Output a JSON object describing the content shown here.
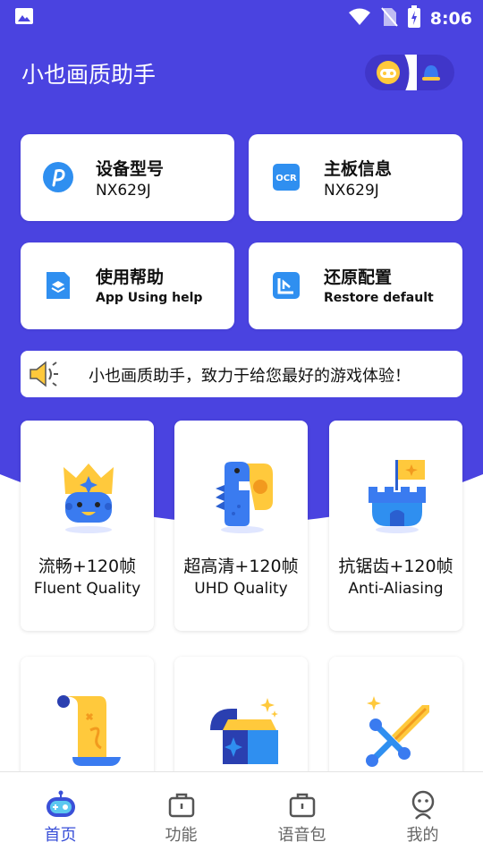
{
  "status_bar": {
    "time": "8:06"
  },
  "header": {
    "title": "小也画质助手"
  },
  "info_cards": [
    {
      "title": "设备型号",
      "value": "NX629J",
      "icon": "brand-p-icon"
    },
    {
      "title": "主板信息",
      "value": "NX629J",
      "icon": "ocr-icon"
    },
    {
      "title": "使用帮助",
      "value": "App Using help",
      "icon": "help-layers-icon"
    },
    {
      "title": "还原配置",
      "value": "Restore default",
      "icon": "restore-icon"
    }
  ],
  "notice": {
    "text": "小也画质助手，致力于给您最好的游戏体验！"
  },
  "modes": [
    {
      "label_cn": "流畅+120帧",
      "label_en": "Fluent Quality",
      "icon": "crown-king-icon"
    },
    {
      "label_cn": "超高清+120帧",
      "label_en": "UHD Quality",
      "icon": "dinosaur-icon"
    },
    {
      "label_cn": "抗锯齿+120帧",
      "label_en": "Anti-Aliasing",
      "icon": "castle-flag-icon"
    },
    {
      "label_cn": "",
      "label_en": "",
      "icon": "scroll-map-icon"
    },
    {
      "label_cn": "",
      "label_en": "",
      "icon": "treasure-chest-icon"
    },
    {
      "label_cn": "",
      "label_en": "",
      "icon": "sword-icon"
    }
  ],
  "bottom_nav": [
    {
      "label": "首页",
      "icon": "gamepad-home-icon",
      "active": true
    },
    {
      "label": "功能",
      "icon": "briefcase-icon",
      "active": false
    },
    {
      "label": "语音包",
      "icon": "voice-pack-icon",
      "active": false
    },
    {
      "label": "我的",
      "icon": "profile-icon",
      "active": false
    }
  ],
  "colors": {
    "primary": "#4a43e0",
    "accent_blue": "#3a50d8",
    "yellow": "#ffc93c"
  }
}
